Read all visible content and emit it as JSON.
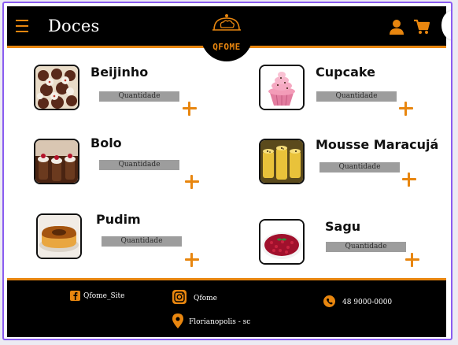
{
  "header": {
    "title": "Doces",
    "logo_text": "QFOME",
    "icons": {
      "menu": "menu-icon",
      "user": "user-icon",
      "cart": "cart-icon"
    },
    "colors": {
      "bar": "#000000",
      "accent": "#e8860f"
    }
  },
  "products": [
    {
      "name": "Beijinho",
      "qty_placeholder": "Quantidade",
      "image": "beijinho-image"
    },
    {
      "name": "Cupcake",
      "qty_placeholder": "Quantidade",
      "image": "cupcake-image"
    },
    {
      "name": "Bolo",
      "qty_placeholder": "Quantidade",
      "image": "bolo-image"
    },
    {
      "name": "Mousse Maracujá",
      "qty_placeholder": "Quantidade",
      "image": "mousse-image"
    },
    {
      "name": "Pudim",
      "qty_placeholder": "Quantidade",
      "image": "pudim-image"
    },
    {
      "name": "Sagu",
      "qty_placeholder": "Quantidade",
      "image": "sagu-image"
    }
  ],
  "footer": {
    "facebook": "Qfome_Site",
    "instagram": "Qfome",
    "whatsapp": "48 9000-0000",
    "location": "Florianopolis - sc"
  }
}
